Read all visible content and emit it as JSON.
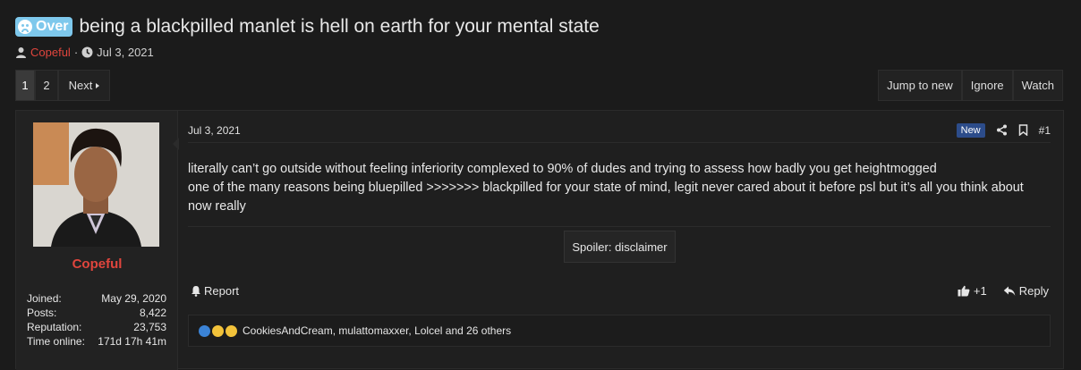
{
  "thread": {
    "prefix": "Over",
    "title": "being a blackpilled manlet is hell on earth for your mental state",
    "author": "Copeful",
    "separator": "·",
    "date": "Jul 3, 2021"
  },
  "pagination": {
    "pages": [
      "1",
      "2"
    ],
    "current": "1",
    "next_label": "Next"
  },
  "thread_actions": {
    "jump_label": "Jump to new",
    "ignore_label": "Ignore",
    "watch_label": "Watch"
  },
  "user": {
    "name": "Copeful",
    "stats": [
      {
        "label": "Joined:",
        "value": "May 29, 2020"
      },
      {
        "label": "Posts:",
        "value": "8,422"
      },
      {
        "label": "Reputation:",
        "value": "23,753"
      },
      {
        "label": "Time online:",
        "value": "171d 17h 41m"
      }
    ]
  },
  "post": {
    "date": "Jul 3, 2021",
    "new_badge": "New",
    "number": "#1",
    "body_lines": [
      "literally can’t go outside without feeling inferiority complexed to 90% of dudes and trying to assess how badly you get heightmogged",
      "one of the many reasons being bluepilled >>>>>>> blackpilled for your state of mind, legit never cared about it before psl but it’s all you think about now really"
    ],
    "spoiler_label": "Spoiler: disclaimer",
    "report_label": "Report",
    "like_count": "+1",
    "reply_label": "Reply",
    "reactors": "CookiesAndCream, mulattomaxxer, Lolcel and 26 others"
  },
  "icons": {
    "prefix": "sad-face-icon",
    "user": "user-icon",
    "clock": "clock-icon",
    "share": "share-icon",
    "bookmark": "bookmark-icon",
    "bell": "bell-icon",
    "thumbs_up": "thumbs-up-icon",
    "reply": "reply-icon"
  },
  "colors": {
    "prefix_bg": "#7ec8ec",
    "username": "#e0453d",
    "new_badge": "#2c4c8a",
    "page_bg": "#1b1b1b"
  }
}
